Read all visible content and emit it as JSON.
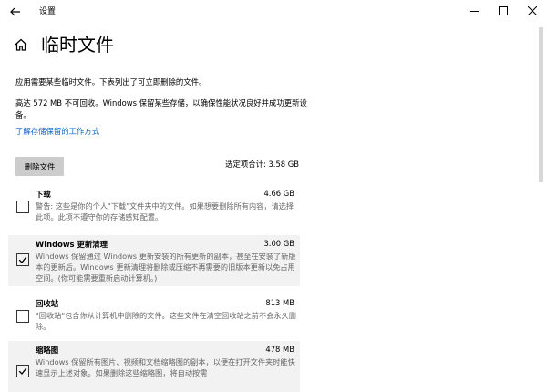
{
  "window": {
    "app_title": "设置",
    "controls": [
      "minimize",
      "maximize",
      "close"
    ]
  },
  "page": {
    "title": "临时文件",
    "description1": "应用需要某些临时文件。下表列出了可立即删除的文件。",
    "description2": "高达 572 MB 不可回收。Windows 保留某些存储，以确保性能状况良好并成功更新设备。",
    "link": "了解存储保留的工作方式",
    "delete_button": "删除文件",
    "total_label": "选定项合计: 3.58 GB"
  },
  "items": [
    {
      "name": "下载",
      "size": "4.66 GB",
      "checked": false,
      "desc": "警告: 这些是你的个人\"下载\"文件夹中的文件。如果想要删除所有内容，请选择此项。此项不遵守你的存储感知配置。"
    },
    {
      "name": "Windows 更新清理",
      "size": "3.00 GB",
      "checked": true,
      "desc": "Windows 保留通过 Windows 更新安装的所有更新的副本，甚至在安装了新版本的更新后。Windows 更新清理将删除或压缩不再需要的旧版本更新以免占用空间。(你可能需要重新启动计算机。)"
    },
    {
      "name": "回收站",
      "size": "813 MB",
      "checked": false,
      "desc": "\"回收站\"包含你从计算机中删除的文件。这些文件在清空回收站之前不会永久删除。"
    },
    {
      "name": "缩略图",
      "size": "478 MB",
      "checked": true,
      "desc": "Windows 保留所有图片、视频和文档缩略图的副本，以便在打开文件夹时能快速显示上述对象。如果删除这些缩略图，将自动按需"
    }
  ],
  "colors": {
    "link": "#0a63c4",
    "button_bg": "#cccccc",
    "selected_bg": "#f2f2f2"
  }
}
